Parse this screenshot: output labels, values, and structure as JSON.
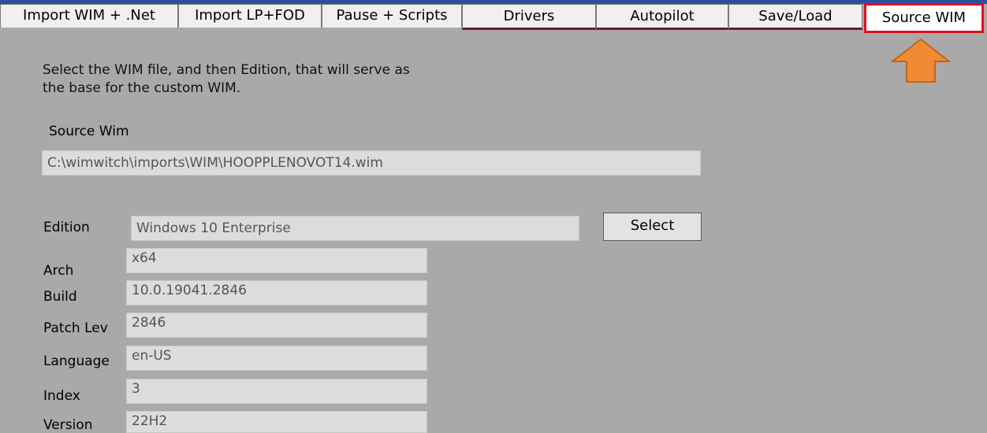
{
  "tabs": [
    {
      "id": "import-wim",
      "label": "Import WIM + .Net"
    },
    {
      "id": "import-lp",
      "label": "Import LP+FOD"
    },
    {
      "id": "pause-scripts",
      "label": "Pause + Scripts"
    },
    {
      "id": "drivers",
      "label": "Drivers"
    },
    {
      "id": "autopilot",
      "label": "Autopilot"
    },
    {
      "id": "save-load",
      "label": "Save/Load"
    },
    {
      "id": "source-wim",
      "label": "Source WIM",
      "active": true
    }
  ],
  "instructions": {
    "line1": "Select the WIM file, and then Edition, that will serve as",
    "line2": "the base for the custom WIM."
  },
  "source_wim": {
    "label": "Source Wim",
    "value": "C:\\wimwitch\\imports\\WIM\\HOOPPLENOVOT14.wim"
  },
  "edition": {
    "label": "Edition",
    "value": "Windows 10 Enterprise"
  },
  "select_button": {
    "label": "Select"
  },
  "fields": {
    "arch": {
      "label": "Arch",
      "value": "x64"
    },
    "build": {
      "label": "Build",
      "value": "10.0.19041.2846"
    },
    "patch": {
      "label": "Patch Lev",
      "value": "2846"
    },
    "language": {
      "label": "Language",
      "value": "en-US"
    },
    "index": {
      "label": "Index",
      "value": "3"
    },
    "version": {
      "label": "Version",
      "value": "22H2"
    }
  },
  "colors": {
    "background": "#a9a9a9",
    "active_tab_border": "#e0101a",
    "arrow": "#f08a34",
    "tab_underline": "#6b1838"
  }
}
